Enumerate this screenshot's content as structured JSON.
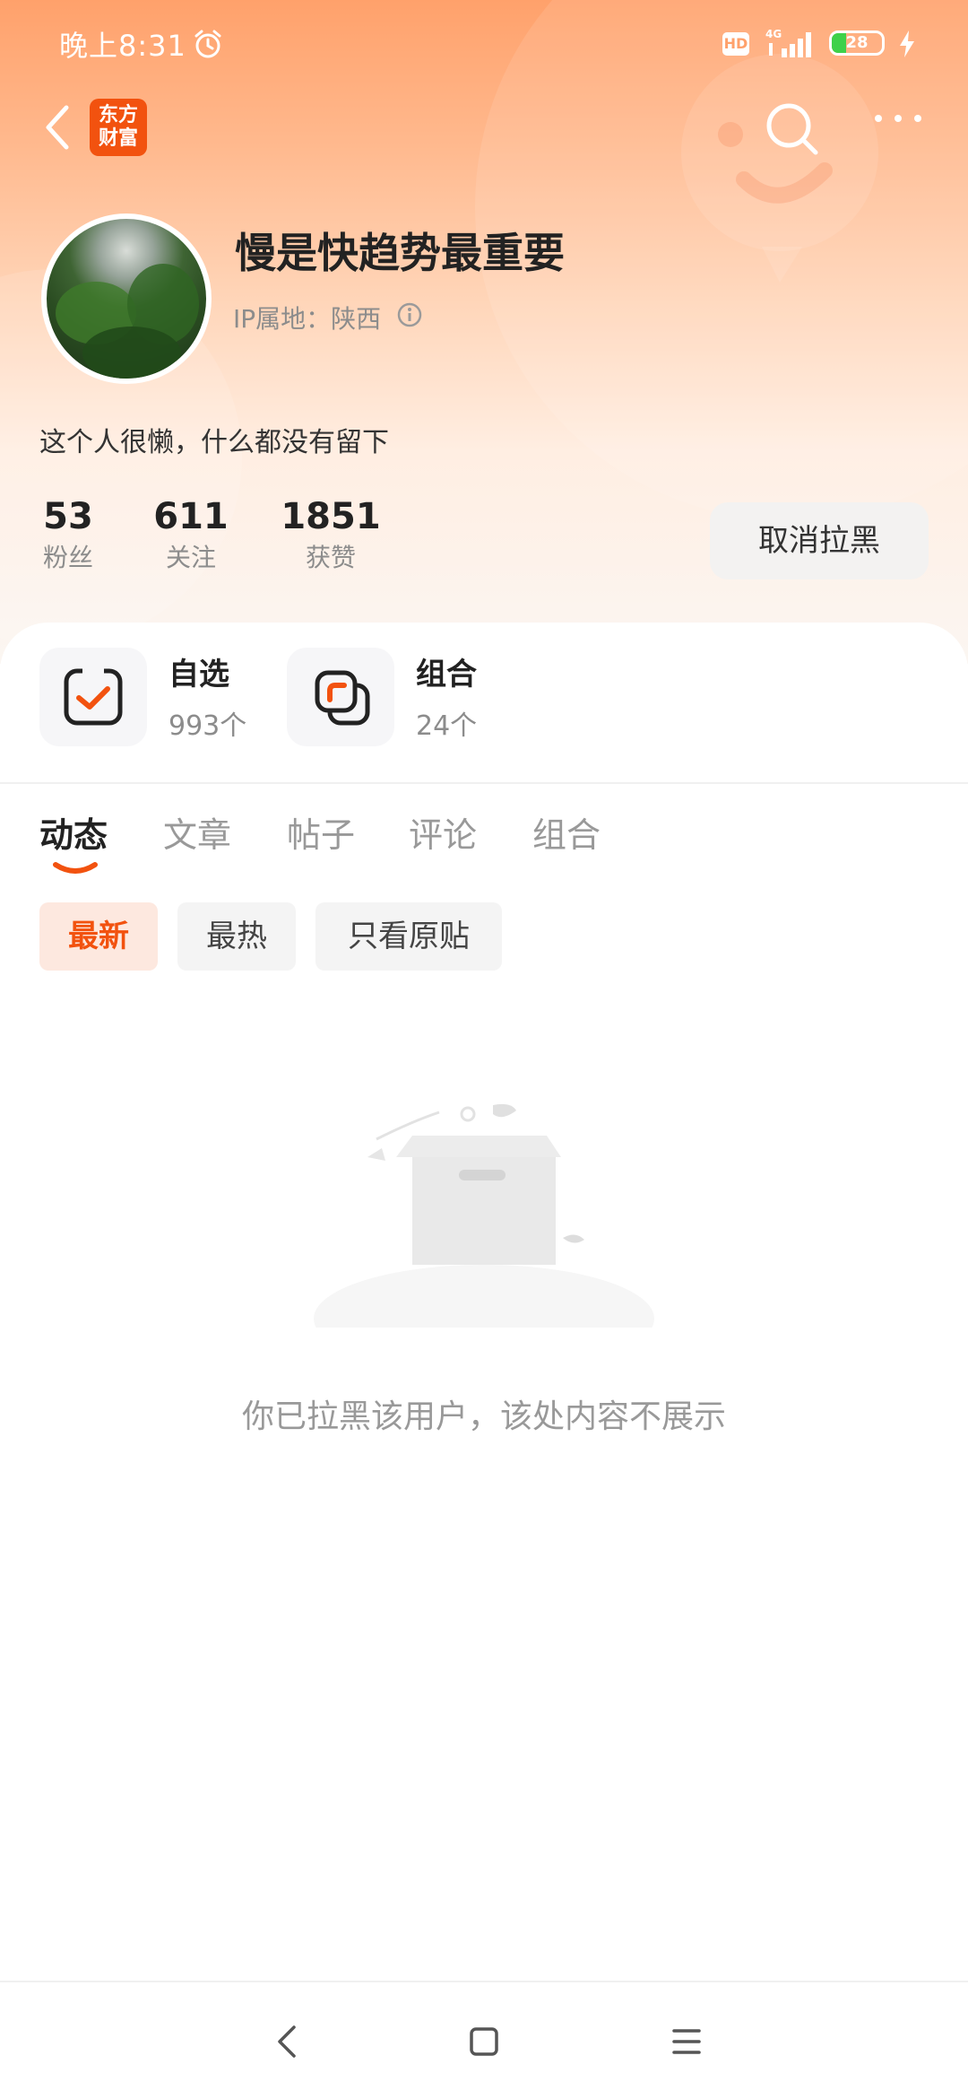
{
  "status_bar": {
    "time": "晚上8:31",
    "network": "4G",
    "hd_label": "HD",
    "battery_text": "28",
    "battery_level": 0.28
  },
  "nav": {
    "logo_line1": "东方",
    "logo_line2": "财富",
    "back_icon": "chevron-left-icon",
    "search_icon": "search-icon",
    "more_icon": "more-horizontal-icon"
  },
  "profile": {
    "username": "慢是快趋势最重要",
    "ip_location": "IP属地：陕西",
    "bio": "这个人很懒，什么都没有留下",
    "stats": [
      {
        "value": "53",
        "label": "粉丝"
      },
      {
        "value": "611",
        "label": "关注"
      },
      {
        "value": "1851",
        "label": "获赞"
      }
    ],
    "unblock_button": "取消拉黑"
  },
  "assets": [
    {
      "title": "自选",
      "count": "993个",
      "icon": "watchlist-check-icon"
    },
    {
      "title": "组合",
      "count": "24个",
      "icon": "portfolio-stack-icon"
    }
  ],
  "tabs": [
    "动态",
    "文章",
    "帖子",
    "评论",
    "组合"
  ],
  "active_tab": "动态",
  "filters": [
    "最新",
    "最热",
    "只看原贴"
  ],
  "active_filter": "最新",
  "empty_state": {
    "message": "你已拉黑该用户，该处内容不展示",
    "icon": "empty-box-icon"
  },
  "colors": {
    "accent": "#f2520f",
    "header_gradient_top": "#ffa16b",
    "battery_green": "#3ed14a"
  }
}
